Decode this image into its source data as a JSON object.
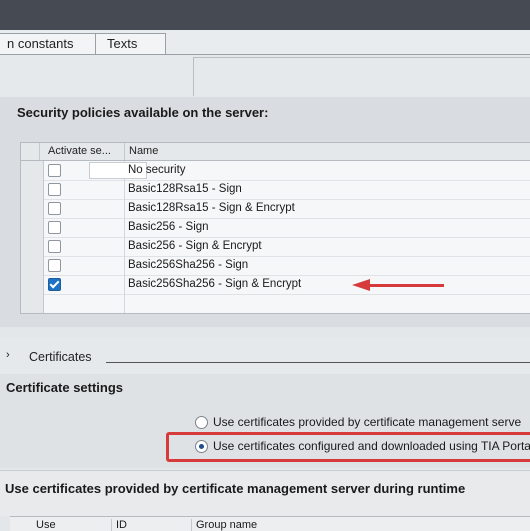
{
  "tabs": [
    {
      "label": "n constants"
    },
    {
      "label": "Texts"
    }
  ],
  "security": {
    "title": "Security policies available on the server:",
    "columns": [
      "Activate se...",
      "Name"
    ],
    "rows": [
      {
        "name": "No security",
        "checked": false
      },
      {
        "name": "Basic128Rsa15 - Sign",
        "checked": false
      },
      {
        "name": "Basic128Rsa15 - Sign & Encrypt",
        "checked": false
      },
      {
        "name": "Basic256 - Sign",
        "checked": false
      },
      {
        "name": "Basic256 - Sign & Encrypt",
        "checked": false
      },
      {
        "name": "Basic256Sha256 - Sign",
        "checked": false
      },
      {
        "name": "Basic256Sha256 - Sign & Encrypt",
        "checked": true
      }
    ]
  },
  "certificates": {
    "chevron": "›",
    "label": "Certificates"
  },
  "settings": {
    "title": "Certificate settings",
    "option1": "Use certificates provided by certificate management serve",
    "option2": "Use certificates configured and downloaded using TIA Porta"
  },
  "runtime": {
    "title": "Use certificates provided by certificate management server during runtime",
    "columns": [
      "Use",
      "ID",
      "Group name"
    ]
  },
  "colors": {
    "accent": "#d63a3a",
    "check": "#1e72c4"
  }
}
